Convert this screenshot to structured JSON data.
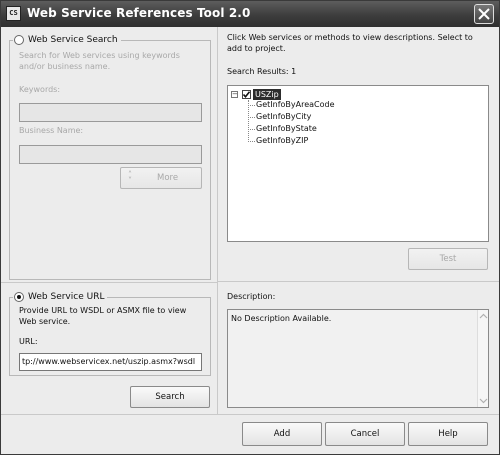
{
  "window": {
    "title": "Web Service References Tool 2.0",
    "app_icon_text": "CS"
  },
  "search_group": {
    "radio_label": "Web Service Search",
    "description": "Search for Web services using keywords and/or business name.",
    "keywords_label": "Keywords:",
    "keywords_value": "",
    "business_label": "Business Name:",
    "business_value": "",
    "more_button": "More",
    "more_icon": "double-chevron-icon",
    "selected": false,
    "enabled": false
  },
  "url_group": {
    "radio_label": "Web Service URL",
    "description": "Provide URL to WSDL or ASMX file to view Web service.",
    "url_label": "URL:",
    "url_value": "tp://www.webservicex.net/uszip.asmx?wsdl",
    "search_button": "Search",
    "selected": true
  },
  "results": {
    "instructions": "Click Web services or methods to view descriptions. Select to add to project.",
    "count_label": "Search Results: 1",
    "tree": {
      "root": {
        "label": "USZip",
        "checked": true,
        "expanded": true,
        "expander_glyph": "−"
      },
      "methods": [
        "GetInfoByAreaCode",
        "GetInfoByCity",
        "GetInfoByState",
        "GetInfoByZIP"
      ]
    },
    "test_button": "Test"
  },
  "description": {
    "label": "Description:",
    "text": "No Description Available."
  },
  "footer": {
    "add_button": "Add",
    "cancel_button": "Cancel",
    "help_button": "Help"
  },
  "colors": {
    "titlebar": "#3d3d3d",
    "window_bg": "#ececec",
    "selection": "#2d2d2d",
    "disabled_text": "#a8a8a8"
  }
}
